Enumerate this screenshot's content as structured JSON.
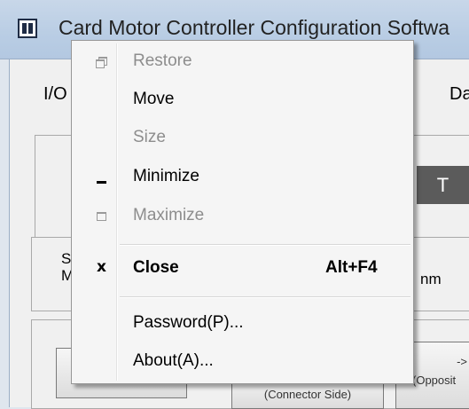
{
  "window": {
    "title": "Card Motor Controller Configuration Softwa",
    "tabs": [
      "I/O",
      "Dat"
    ],
    "dark_button_label": "T",
    "side_texts": [
      "S",
      "M"
    ],
    "mid_text": "nm",
    "buttons": [
      "(Connector Side)",
      "(Opposit",
      "->"
    ]
  },
  "menu": {
    "items": [
      {
        "label": "Restore",
        "icon": "restore-icon",
        "enabled": false
      },
      {
        "label": "Move",
        "icon": "",
        "enabled": true
      },
      {
        "label": "Size",
        "icon": "",
        "enabled": false
      },
      {
        "label": "Minimize",
        "icon": "minimize-icon",
        "enabled": true
      },
      {
        "label": "Maximize",
        "icon": "maximize-icon",
        "enabled": false
      },
      {
        "label": "Close",
        "icon": "close-icon",
        "enabled": true,
        "shortcut": "Alt+F4"
      },
      {
        "label": "Password(P)...",
        "icon": "",
        "enabled": true
      },
      {
        "label": "About(A)...",
        "icon": "",
        "enabled": true
      }
    ],
    "close_glyph": "x"
  }
}
